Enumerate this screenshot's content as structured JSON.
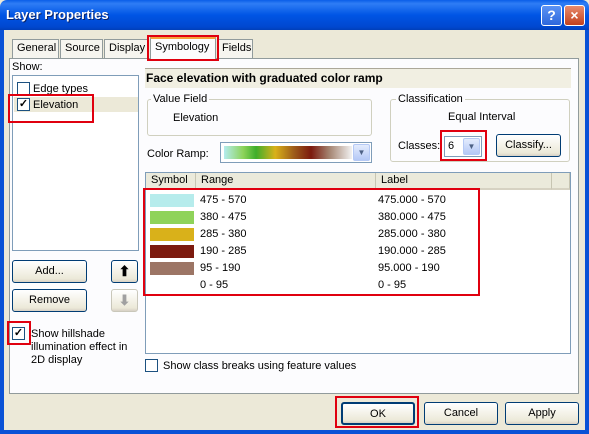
{
  "window": {
    "title": "Layer Properties",
    "help_glyph": "?",
    "close_glyph": "×"
  },
  "tabs": [
    {
      "label": "General"
    },
    {
      "label": "Source"
    },
    {
      "label": "Display"
    },
    {
      "label": "Symbology"
    },
    {
      "label": "Fields"
    }
  ],
  "show": {
    "label": "Show:",
    "items": [
      {
        "label": "Edge types",
        "checked": false
      },
      {
        "label": "Elevation",
        "checked": true
      }
    ],
    "add_label": "Add...",
    "remove_label": "Remove",
    "up_glyph": "⬆",
    "down_glyph": "⬇",
    "hillshade_label_1": "Show hillshade",
    "hillshade_label_2": "illumination effect in",
    "hillshade_label_3": "2D display",
    "hillshade_checked": true
  },
  "symbology": {
    "heading": "Face elevation with graduated color ramp",
    "value_field_title": "Value Field",
    "value_field_value": "Elevation",
    "classification_title": "Classification",
    "classification_method": "Equal Interval",
    "classes_label": "Classes:",
    "classes_value": "6",
    "classify_label": "Classify...",
    "color_ramp_label": "Color Ramp:",
    "columns": {
      "symbol": "Symbol",
      "range": "Range",
      "label": "Label"
    },
    "rows": [
      {
        "range": "475 - 570",
        "label": "475.000 - 570",
        "color": "#b6ecec"
      },
      {
        "range": "380 - 475",
        "label": "380.000 - 475",
        "color": "#8fd35a"
      },
      {
        "range": "285 - 380",
        "label": "285.000 - 380",
        "color": "#d9b11a"
      },
      {
        "range": "190 - 285",
        "label": "190.000 - 285",
        "color": "#7c1a0e"
      },
      {
        "range": "95 - 190",
        "label": "95.000 - 190",
        "color": "#9c7565"
      },
      {
        "range": "0 - 95",
        "label": "0 - 95",
        "color": "#ffffff"
      }
    ],
    "show_breaks_label": "Show class breaks using feature values"
  },
  "buttons": {
    "ok": "OK",
    "cancel": "Cancel",
    "apply": "Apply"
  },
  "colors": {
    "highlight": "#e0000f",
    "titlebar": "#0055e5"
  }
}
